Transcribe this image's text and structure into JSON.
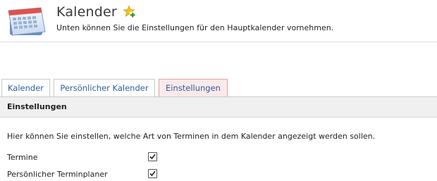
{
  "header": {
    "title": "Kalender",
    "subtitle": "Unten können Sie die Einstellungen für den Hauptkalender vornehmen.",
    "app_icon": "calendar-icon",
    "add_icon": "star-plus-icon"
  },
  "tabs": [
    {
      "label": "Kalender",
      "active": false
    },
    {
      "label": "Persönlicher Kalender",
      "active": false
    },
    {
      "label": "Einstellungen",
      "active": true
    }
  ],
  "section": {
    "title": "Einstellungen",
    "description": "Hier können Sie einstellen, welche Art von Terminen in dem Kalender angezeigt werden sollen."
  },
  "settings": [
    {
      "label": "Termine",
      "checked": true
    },
    {
      "label": "Persönlicher Terminplaner",
      "checked": true
    }
  ],
  "colors": {
    "link": "#2c5f9e",
    "active_tab_bg": "#fbe9ea",
    "active_tab_border": "#e3a2a6",
    "section_bg": "#f0f0f0"
  }
}
